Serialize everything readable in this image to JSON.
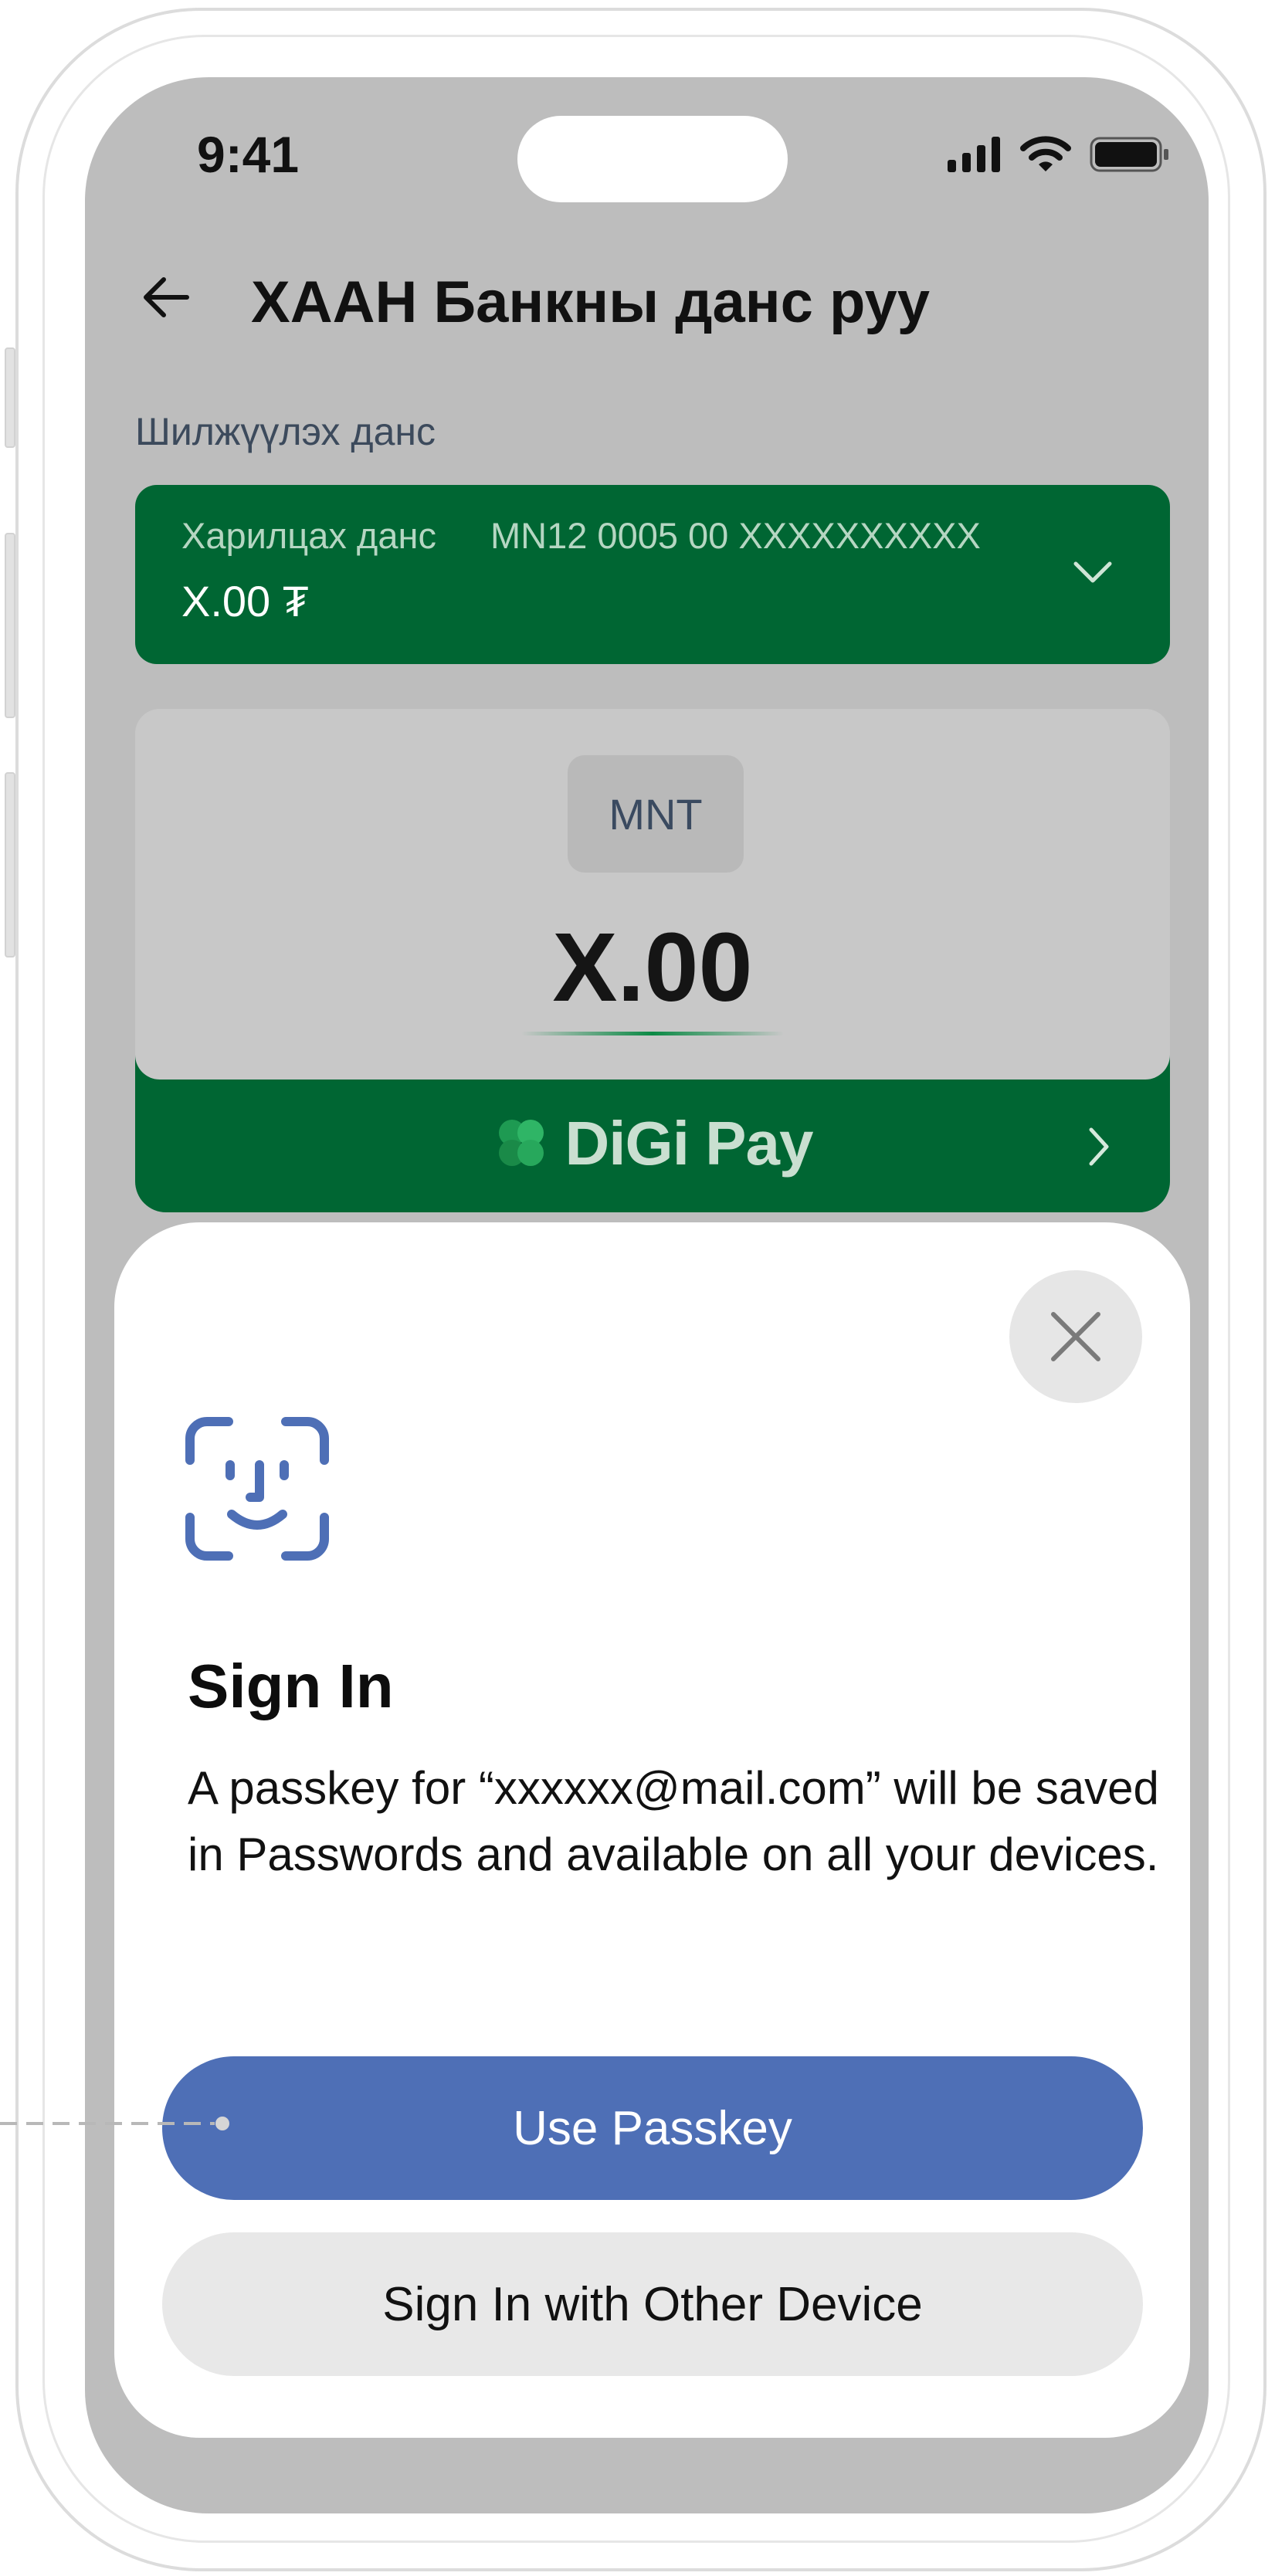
{
  "status_bar": {
    "time": "9:41",
    "icons": [
      "signal-icon",
      "wifi-icon",
      "battery-icon"
    ]
  },
  "header": {
    "back_icon": "arrow-left-icon",
    "title": "ХААН Банкны данс руу"
  },
  "transfer": {
    "section_label": "Шилжүүлэх данс",
    "account": {
      "type": "Харилцах данс",
      "number": "MN12 0005 00 XXXXXXXXXX",
      "balance": "X.00 ₮"
    },
    "currency": "MNT",
    "amount": "X.00",
    "promo": {
      "brand": "DiGi Pay",
      "icon": "clover-icon"
    }
  },
  "sheet": {
    "icon": "face-id-icon",
    "title": "Sign In",
    "description": "A passkey for “xxxxxx@mail.com” will be saved in Passwords and available on all your devices.",
    "primary_button": "Use Passkey",
    "secondary_button": "Sign In with Other Device"
  },
  "colors": {
    "brand_green": "#006633",
    "passkey_blue": "#4e6fb6",
    "overlay_gray": "#bdbdbd"
  }
}
